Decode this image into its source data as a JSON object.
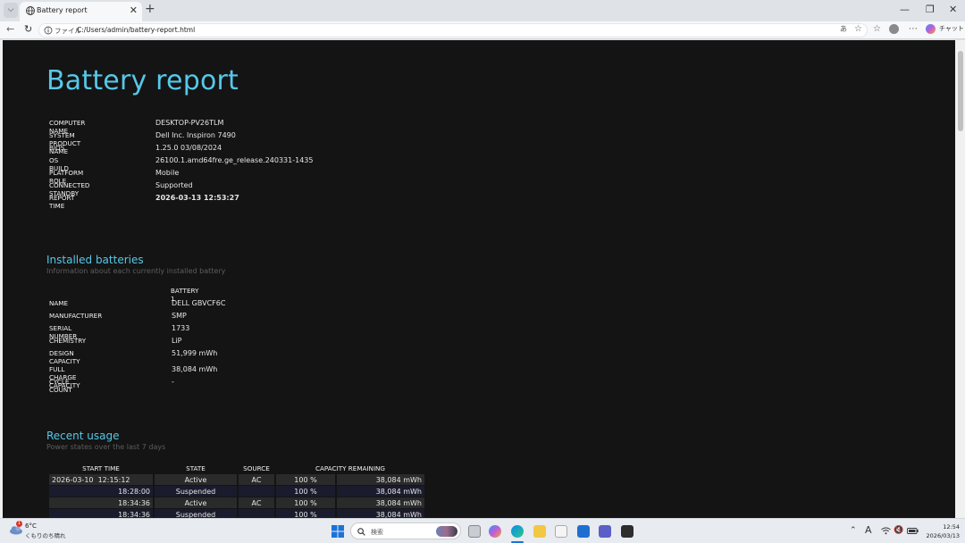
{
  "browser": {
    "tab_title": "Battery report",
    "address_protocol": "ファイル",
    "address_url": "C:/Users/admin/battery-report.html",
    "copilot_label": "チャット"
  },
  "report": {
    "title": "Battery report",
    "system": [
      {
        "key": "COMPUTER NAME",
        "value": "DESKTOP-PV26TLM"
      },
      {
        "key": "SYSTEM PRODUCT NAME",
        "value": "Dell Inc. Inspiron 7490"
      },
      {
        "key": "BIOS",
        "value": "1.25.0 03/08/2024"
      },
      {
        "key": "OS BUILD",
        "value": "26100.1.amd64fre.ge_release.240331-1435"
      },
      {
        "key": "PLATFORM ROLE",
        "value": "Mobile"
      },
      {
        "key": "CONNECTED STANDBY",
        "value": "Supported"
      },
      {
        "key": "REPORT TIME",
        "value": "2026-03-13  12:53:27"
      }
    ]
  },
  "installed": {
    "heading": "Installed batteries",
    "subtitle": "Information about each currently installed battery",
    "column": "BATTERY 1",
    "rows": [
      {
        "key": "NAME",
        "value": "DELL GBVCF6C"
      },
      {
        "key": "MANUFACTURER",
        "value": "SMP"
      },
      {
        "key": "SERIAL NUMBER",
        "value": "1733"
      },
      {
        "key": "CHEMISTRY",
        "value": "LiP"
      },
      {
        "key": "DESIGN CAPACITY",
        "value": "51,999 mWh"
      },
      {
        "key": "FULL CHARGE CAPACITY",
        "value": "38,084 mWh"
      },
      {
        "key": "CYCLE COUNT",
        "value": "-"
      }
    ]
  },
  "usage": {
    "heading": "Recent usage",
    "subtitle": "Power states over the last 7 days",
    "headers": [
      "START TIME",
      "STATE",
      "SOURCE",
      "CAPACITY REMAINING"
    ],
    "rows": [
      {
        "date": "2026-03-10",
        "time": "12:15:12",
        "state": "Active",
        "source": "AC",
        "pct": "100 %",
        "mwh": "38,084 mWh"
      },
      {
        "date": "",
        "time": "18:28:00",
        "state": "Suspended",
        "source": "",
        "pct": "100 %",
        "mwh": "38,084 mWh"
      },
      {
        "date": "",
        "time": "18:34:36",
        "state": "Active",
        "source": "AC",
        "pct": "100 %",
        "mwh": "38,084 mWh"
      },
      {
        "date": "",
        "time": "18:34:36",
        "state": "Suspended",
        "source": "",
        "pct": "100 %",
        "mwh": "38,084 mWh"
      }
    ]
  },
  "taskbar": {
    "weather_temp": "6°C",
    "weather_cond": "くもりのち晴れ",
    "search_label": "検索",
    "ime_label": "A",
    "clock_time": "12:54",
    "clock_date": "2026/03/13",
    "notification_count": "1"
  }
}
